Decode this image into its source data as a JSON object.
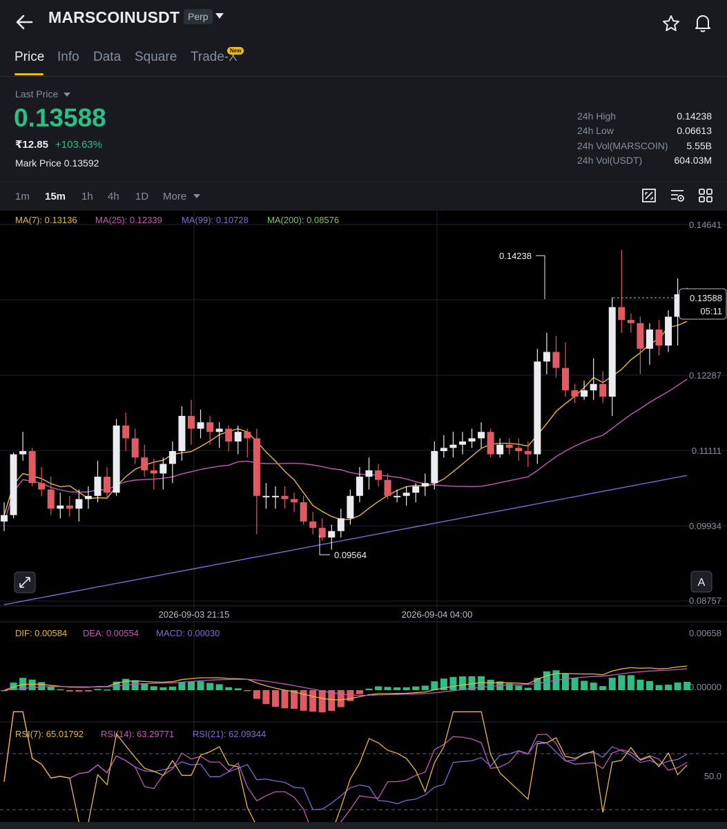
{
  "header": {
    "symbol": "MARSCOINUSDT",
    "contract_type": "Perp"
  },
  "tabs": [
    {
      "label": "Price"
    },
    {
      "label": "Info"
    },
    {
      "label": "Data"
    },
    {
      "label": "Square"
    },
    {
      "label": "Trade-X"
    }
  ],
  "tab_badge": "New",
  "ticker": {
    "last_price_label": "Last Price",
    "last_price": "0.13588",
    "inr_price": "₹12.85",
    "change_pct": "+103.63%",
    "mark_price_label": "Mark Price",
    "mark_price": "0.13592"
  },
  "stats": [
    {
      "label": "24h High",
      "value": "0.14238"
    },
    {
      "label": "24h Low",
      "value": "0.06613"
    },
    {
      "label": "24h Vol(MARSCOIN)",
      "value": "5.55B"
    },
    {
      "label": "24h Vol(USDT)",
      "value": "604.03M"
    }
  ],
  "timeframes": [
    {
      "label": "1m"
    },
    {
      "label": "15m",
      "active": true
    },
    {
      "label": "1h"
    },
    {
      "label": "4h"
    },
    {
      "label": "1D"
    },
    {
      "label": "More"
    }
  ],
  "colors": {
    "up": "#2ebd85",
    "down": "#e05a63",
    "accent": "#f0b90b",
    "ma7": "#e8b64c",
    "ma25": "#c15bb6",
    "ma99": "#7d6cd0",
    "ma200": "#7fc46a"
  },
  "chart_data": {
    "type": "candlestick",
    "indicators": {
      "ma7": "MA(7): 0.13136",
      "ma25": "MA(25): 0.12339",
      "ma99": "MA(99): 0.10728",
      "ma200": "MA(200): 0.08576"
    },
    "y_axis_ticks": [
      "0.14641",
      "0.12287",
      "0.11111",
      "0.09934",
      "0.08757"
    ],
    "ylim": [
      0.08757,
      0.14641
    ],
    "x_axis_ticks": [
      "2026-09-03 21:15",
      "2026-09-04 04:00"
    ],
    "high_label": "0.14238",
    "low_label": "0.09564",
    "current_price": "0.13588",
    "countdown": "05:11",
    "scale_button": "A",
    "candles": [
      [
        0.1,
        0.101,
        0.0985,
        0.103
      ],
      [
        0.101,
        0.1105,
        0.1005,
        0.1108
      ],
      [
        0.1105,
        0.111,
        0.1095,
        0.114
      ],
      [
        0.111,
        0.106,
        0.1055,
        0.1115
      ],
      [
        0.106,
        0.105,
        0.104,
        0.1085
      ],
      [
        0.105,
        0.102,
        0.101,
        0.107
      ],
      [
        0.102,
        0.1025,
        0.1005,
        0.1045
      ],
      [
        0.1025,
        0.102,
        0.1008,
        0.104
      ],
      [
        0.102,
        0.1035,
        0.1,
        0.105
      ],
      [
        0.1035,
        0.104,
        0.102,
        0.1055
      ],
      [
        0.104,
        0.107,
        0.103,
        0.1095
      ],
      [
        0.107,
        0.1045,
        0.1035,
        0.1085
      ],
      [
        0.1045,
        0.115,
        0.104,
        0.116
      ],
      [
        0.115,
        0.113,
        0.111,
        0.117
      ],
      [
        0.113,
        0.11,
        0.109,
        0.1145
      ],
      [
        0.11,
        0.108,
        0.107,
        0.112
      ],
      [
        0.108,
        0.1075,
        0.105,
        0.1098
      ],
      [
        0.1075,
        0.109,
        0.105,
        0.11
      ],
      [
        0.109,
        0.111,
        0.106,
        0.1125
      ],
      [
        0.111,
        0.1165,
        0.1095,
        0.118
      ],
      [
        0.1165,
        0.1145,
        0.112,
        0.119
      ],
      [
        0.1145,
        0.1155,
        0.113,
        0.1175
      ],
      [
        0.1155,
        0.114,
        0.112,
        0.1165
      ],
      [
        0.114,
        0.1145,
        0.1115,
        0.1155
      ],
      [
        0.1145,
        0.1125,
        0.111,
        0.115
      ],
      [
        0.1125,
        0.114,
        0.1105,
        0.115
      ],
      [
        0.114,
        0.113,
        0.11,
        0.1145
      ],
      [
        0.113,
        0.104,
        0.098,
        0.1145
      ],
      [
        0.104,
        0.104,
        0.102,
        0.106
      ],
      [
        0.104,
        0.104,
        0.102,
        0.1055
      ],
      [
        0.104,
        0.1035,
        0.102,
        0.1055
      ],
      [
        0.1035,
        0.103,
        0.1015,
        0.1045
      ],
      [
        0.103,
        0.1,
        0.0995,
        0.104
      ],
      [
        0.1,
        0.099,
        0.098,
        0.1015
      ],
      [
        0.099,
        0.0975,
        0.097,
        0.1005
      ],
      [
        0.0975,
        0.0985,
        0.0956,
        0.0995
      ],
      [
        0.0985,
        0.1005,
        0.0975,
        0.102
      ],
      [
        0.1005,
        0.104,
        0.0995,
        0.105
      ],
      [
        0.104,
        0.107,
        0.103,
        0.1085
      ],
      [
        0.107,
        0.108,
        0.105,
        0.11
      ],
      [
        0.108,
        0.1065,
        0.1055,
        0.109
      ],
      [
        0.1065,
        0.104,
        0.1035,
        0.1075
      ],
      [
        0.104,
        0.104,
        0.103,
        0.105
      ],
      [
        0.104,
        0.1045,
        0.1025,
        0.1055
      ],
      [
        0.1045,
        0.1055,
        0.103,
        0.106
      ],
      [
        0.1055,
        0.106,
        0.104,
        0.1075
      ],
      [
        0.106,
        0.111,
        0.105,
        0.1125
      ],
      [
        0.111,
        0.1115,
        0.11,
        0.1135
      ],
      [
        0.1115,
        0.112,
        0.11,
        0.114
      ],
      [
        0.112,
        0.1125,
        0.1105,
        0.114
      ],
      [
        0.1125,
        0.113,
        0.1115,
        0.1145
      ],
      [
        0.113,
        0.114,
        0.1115,
        0.1155
      ],
      [
        0.114,
        0.1105,
        0.11,
        0.1145
      ],
      [
        0.1105,
        0.112,
        0.11,
        0.113
      ],
      [
        0.112,
        0.1115,
        0.1105,
        0.113
      ],
      [
        0.1115,
        0.111,
        0.1095,
        0.113
      ],
      [
        0.111,
        0.1105,
        0.1085,
        0.1125
      ],
      [
        0.1105,
        0.125,
        0.109,
        0.127
      ],
      [
        0.125,
        0.1265,
        0.123,
        0.1295
      ],
      [
        0.1265,
        0.124,
        0.1225,
        0.129
      ],
      [
        0.124,
        0.1205,
        0.1195,
        0.128
      ],
      [
        0.1205,
        0.1195,
        0.1185,
        0.1215
      ],
      [
        0.1195,
        0.1205,
        0.119,
        0.122
      ],
      [
        0.1205,
        0.1215,
        0.119,
        0.1255
      ],
      [
        0.1215,
        0.1195,
        0.1185,
        0.1235
      ],
      [
        0.1195,
        0.1335,
        0.1165,
        0.135
      ],
      [
        0.1335,
        0.1315,
        0.1295,
        0.1424
      ],
      [
        0.1315,
        0.131,
        0.1295,
        0.1325
      ],
      [
        0.131,
        0.127,
        0.123,
        0.132
      ],
      [
        0.127,
        0.13,
        0.1245,
        0.131
      ],
      [
        0.13,
        0.1275,
        0.126,
        0.1315
      ],
      [
        0.1275,
        0.132,
        0.1265,
        0.133
      ],
      [
        0.132,
        0.1355,
        0.1275,
        0.138
      ],
      [
        0.1355,
        0.1359,
        0.1342,
        0.1365
      ]
    ]
  },
  "macd": {
    "dif_label": "DIF: 0.00584",
    "dea_label": "DEA: 0.00554",
    "macd_label": "MACD: 0.00030",
    "y_ticks": [
      "0.00658",
      "0.00000"
    ]
  },
  "rsi": {
    "rsi7_label": "RSI(7): 65.01792",
    "rsi14_label": "RSI(14): 63.29771",
    "rsi21_label": "RSI(21): 62.09344",
    "y_tick": "50.0"
  }
}
